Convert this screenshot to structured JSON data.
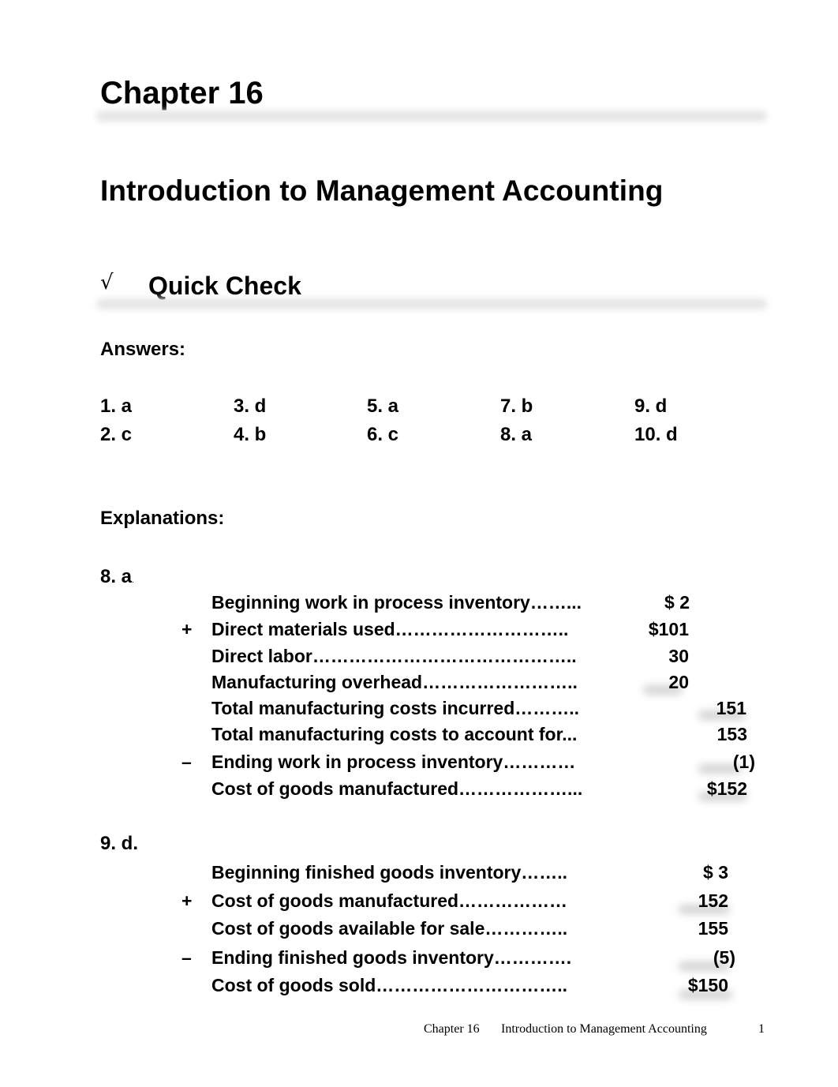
{
  "chapter_title": "Chapter 16",
  "chapter_subtitle": "Introduction to Management Accounting",
  "section": {
    "icon": "√",
    "title": "Quick Check"
  },
  "answers_label": "Answers:",
  "answers": [
    [
      "1.  a",
      "3.  d",
      "5.  a",
      "7.  b",
      "9.  d"
    ],
    [
      "2.  c",
      "4.  b",
      "6.  c",
      "8.  a",
      "10.  d"
    ]
  ],
  "explanations_label": "Explanations:",
  "explanations": [
    {
      "heading": "8. a",
      "heading_suffix": ".",
      "rows": [
        {
          "sign": "",
          "label": "Beginning work in process inventory……...",
          "col1": "",
          "col2": "$    2"
        },
        {
          "sign": "+",
          "label": "Direct materials used………………………..",
          "col1": "$101",
          "col2": ""
        },
        {
          "sign": "",
          "label": "Direct labor……………………………………..",
          "col1": "30",
          "col2": ""
        },
        {
          "sign": "",
          "label": "Manufacturing  overhead……………………..",
          "col1": "20",
          "col2": ""
        },
        {
          "sign": "",
          "label": "Total manufacturing costs incurred………..",
          "col1": "",
          "col2": "151"
        },
        {
          "sign": "",
          "label": "Total manufacturing costs to account for...",
          "col1": "",
          "col2": "153"
        },
        {
          "sign": "–",
          "label": "Ending work in process inventory…………",
          "col1": "",
          "col2": "(1)"
        },
        {
          "sign": "",
          "label": "Cost of goods manufactured………………...",
          "col1": "",
          "col2": "$152"
        }
      ]
    },
    {
      "heading": "9. d.",
      "heading_suffix": "",
      "rows": [
        {
          "sign": "",
          "label": "Beginning finished goods inventory……..",
          "col1": "$    3"
        },
        {
          "sign": "+",
          "label": "Cost of goods manufactured………………",
          "col1": "152"
        },
        {
          "sign": "",
          "label": "Cost of goods available for sale…………..",
          "col1": "155"
        },
        {
          "sign": "–",
          "label": "Ending finished goods inventory………….",
          "col1": "(5)"
        },
        {
          "sign": "",
          "label": "Cost of goods sold…………………………..",
          "col1": "$150"
        }
      ]
    }
  ],
  "footer": {
    "chapter": "Chapter 16",
    "title": "Introduction to Management Accounting",
    "page_number": "1"
  }
}
